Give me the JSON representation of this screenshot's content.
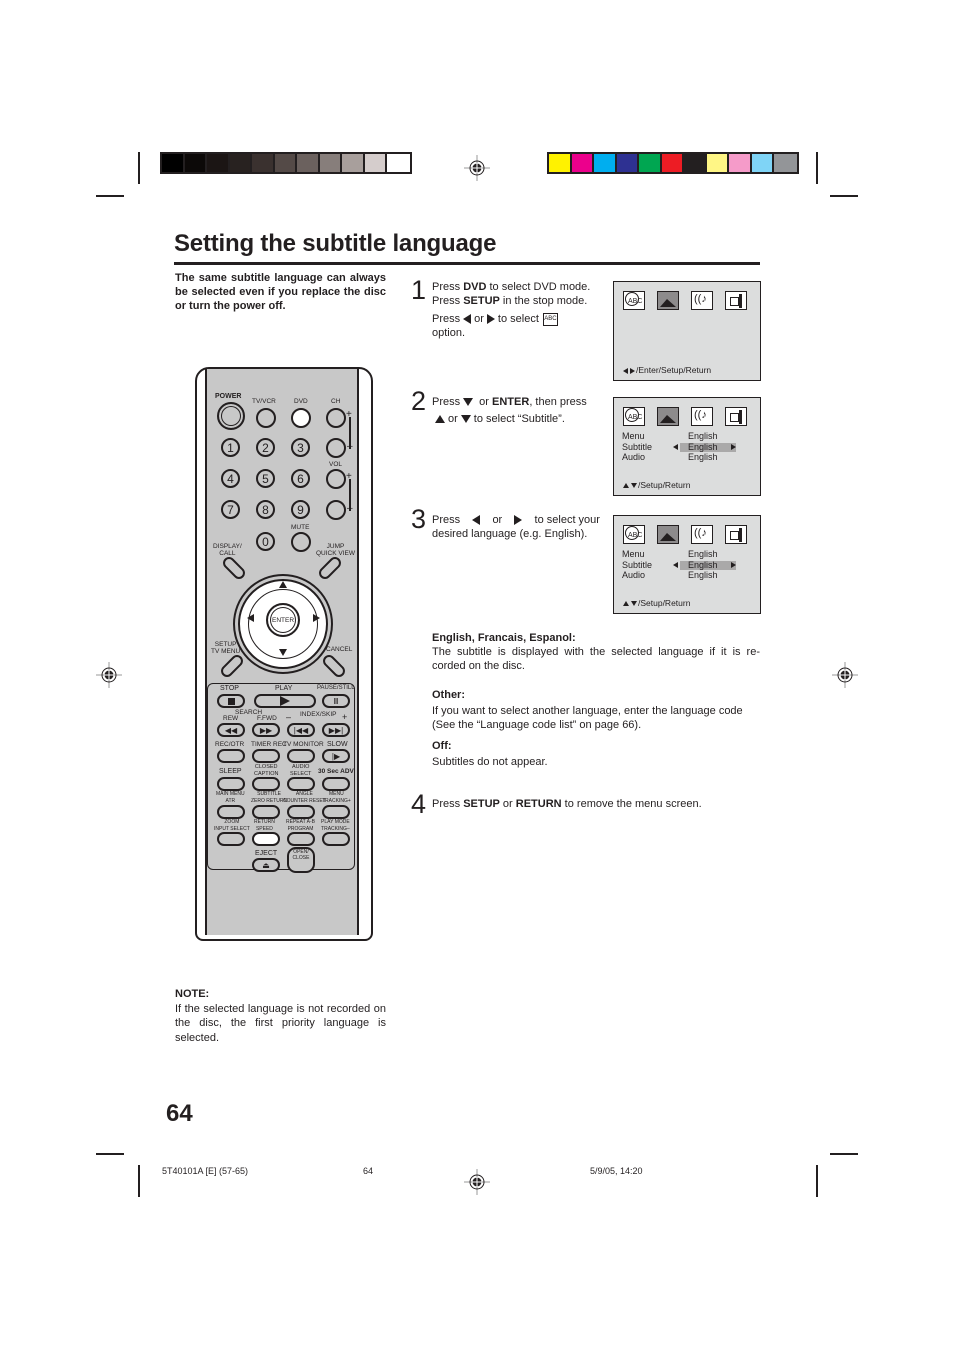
{
  "print_marks": {
    "gray_swatches": [
      "#000000",
      "#0c0908",
      "#1b1514",
      "#282220",
      "#3a312f",
      "#544a47",
      "#6b615e",
      "#877e7b",
      "#a89f9c",
      "#d5cdcc",
      "#ffffff"
    ],
    "color_swatches": [
      "#fff200",
      "#ec008c",
      "#00aeef",
      "#2e3192",
      "#00a651",
      "#ed1c24",
      "#231f20",
      "#fff685",
      "#f59bc9",
      "#7fd4f6",
      "#939598"
    ]
  },
  "title": "Setting the subtitle language",
  "intro": "The same subtitle language can always be selected even if you replace the disc or turn the power off.",
  "steps": [
    {
      "num": "1",
      "line1_pre": "Press ",
      "line1_bold": "DVD",
      "line1_post": " to select DVD mode.",
      "line2_pre": "Press ",
      "line2_bold": "SETUP",
      "line2_post": " in the stop mode.",
      "line3_pre": "Press",
      "line3_or": "or",
      "line3_post": "to select",
      "line4": "option."
    },
    {
      "num": "2",
      "line1_pre": "Press",
      "line1_or": " or ",
      "line1_bold": "ENTER",
      "line1_post": ", then press",
      "line2_or": "or",
      "line2_post": "to select “Subtitle”."
    },
    {
      "num": "3",
      "line1_pre": "Press",
      "line1_or": "or",
      "line1_post": "to select your",
      "line2": "desired language (e.g. English)."
    },
    {
      "num": "4",
      "pre": "Press ",
      "bold1": "SETUP",
      "mid": " or ",
      "bold2": "RETURN",
      "post": " to remove the menu screen."
    }
  ],
  "osd": {
    "icons": [
      "language-icon",
      "picture-icon",
      "audio-icon",
      "setup-icon"
    ],
    "screen1_footer": "/Enter/Setup/Return",
    "screen2": {
      "rows": [
        {
          "label": "Menu",
          "value": "English"
        },
        {
          "label": "Subtitle",
          "value": "English"
        },
        {
          "label": "Audio",
          "value": "English"
        }
      ],
      "selected_row": "Subtitle",
      "footer": "/Setup/Return"
    },
    "screen3": {
      "rows": [
        {
          "label": "Menu",
          "value": "English"
        },
        {
          "label": "Subtitle",
          "value": "English"
        },
        {
          "label": "Audio",
          "value": "English"
        }
      ],
      "selected_row": "Subtitle",
      "footer": "/Setup/Return"
    }
  },
  "options": [
    {
      "heading": "English, Francais, Espanol:",
      "text": "The subtitle is displayed with the selected language if it is re-corded on the disc."
    },
    {
      "heading": "Other:",
      "text": "If you want to select another language, enter the language code (See the “Language code list” on page 66)."
    },
    {
      "heading": "Off:",
      "text": "Subtitles do not appear."
    }
  ],
  "note": {
    "heading": "NOTE:",
    "text": "If the selected language is not recorded on the disc, the first priority language is selected."
  },
  "remote": {
    "labels": {
      "power": "POWER",
      "tvvcr": "TV/VCR",
      "dvd": "DVD",
      "ch": "CH",
      "vol": "VOL",
      "mute": "MUTE",
      "display": "DISPLAY/\nCALL",
      "jump": "JUMP\nQUICK VIEW",
      "enter": "ENTER",
      "setup": "SETUP\nTV MENU",
      "cancel": "CANCEL",
      "stop": "STOP",
      "play": "PLAY",
      "pause": "PAUSE/STILL",
      "search": "SEARCH",
      "rew": "REW",
      "ffwd": "F.FWD",
      "index": "INDEX/SKIP",
      "recotr": "REC/OTR",
      "timerrec": "TIMER REC",
      "tvmonitor": "TV MONITOR",
      "slow": "SLOW",
      "sleep": "SLEEP",
      "closedcaption": "CLOSED\nCAPTION",
      "audioselect": "AUDIO\nSELECT",
      "adv": "30 Sec ADV",
      "mainmenu": "MAIN MENU\nATR",
      "subtitle": "SUBTITLE\nZERO RETURN",
      "angle": "ANGLE\nCOUNTER RESET",
      "menu": "MENU\nTRACKING+",
      "zoom": "ZOOM\nINPUT SELECT",
      "return": "RETURN\nSPEED",
      "repeat": "REPEAT A-B\nPROGRAM",
      "playmode": "PLAY MODE\nTRACKING–",
      "eject": "EJECT",
      "openclose": "OPEN/\nCLOSE"
    },
    "digits": [
      "1",
      "2",
      "3",
      "4",
      "5",
      "6",
      "7",
      "8",
      "9",
      "0"
    ],
    "highlighted_buttons": [
      "DVD",
      "RETURN/SPEED"
    ]
  },
  "page_number": "64",
  "footer": {
    "doc_code": "5T40101A [E] (57-65)",
    "page": "64",
    "date": "5/9/05, 14:20"
  }
}
